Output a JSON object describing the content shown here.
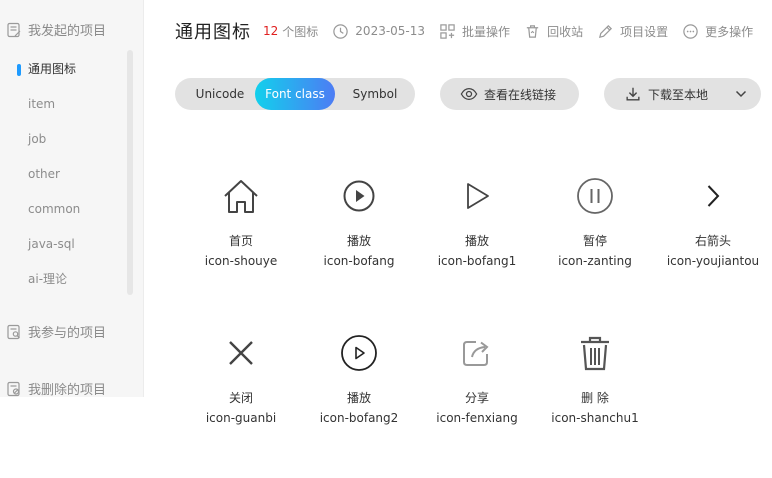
{
  "sidebar": {
    "my_projects": "我发起的项目",
    "joined_projects": "我参与的项目",
    "deleted_projects": "我删除的项目",
    "items": [
      {
        "label": "通用图标"
      },
      {
        "label": "item"
      },
      {
        "label": "job"
      },
      {
        "label": "other"
      },
      {
        "label": "common"
      },
      {
        "label": "java-sql"
      },
      {
        "label": "ai-理论"
      }
    ]
  },
  "header": {
    "title": "通用图标",
    "count": "12",
    "count_label": "个图标",
    "date": "2023-05-13",
    "batch": "批量操作",
    "recycle": "回收站",
    "settings": "项目设置",
    "more": "更多操作"
  },
  "toolbar": {
    "tabs": [
      "Unicode",
      "Font class",
      "Symbol"
    ],
    "active_tab": "Font class",
    "view_link": "查看在线链接",
    "download": "下载至本地"
  },
  "icons": [
    {
      "name": "首页",
      "class": "icon-shouye",
      "icon": "home-icon"
    },
    {
      "name": "播放",
      "class": "icon-bofang",
      "icon": "play-circle-icon"
    },
    {
      "name": "播放",
      "class": "icon-bofang1",
      "icon": "play-triangle-icon"
    },
    {
      "name": "暂停",
      "class": "icon-zanting",
      "icon": "pause-circle-icon"
    },
    {
      "name": "右箭头",
      "class": "icon-youjiantou",
      "icon": "chevron-right-icon"
    },
    {
      "name": "关闭",
      "class": "icon-guanbi",
      "icon": "close-icon"
    },
    {
      "name": "播放",
      "class": "icon-bofang2",
      "icon": "play-circle-icon"
    },
    {
      "name": "分享",
      "class": "icon-fenxiang",
      "icon": "share-icon"
    },
    {
      "name": "删 除",
      "class": "icon-shanchu1",
      "icon": "trash-icon"
    }
  ],
  "colors": {
    "accent_gradient_start": "#12d0ec",
    "accent_gradient_end": "#4d7cf4",
    "count_red": "#e02020",
    "active_marker": "#1e9bff"
  }
}
